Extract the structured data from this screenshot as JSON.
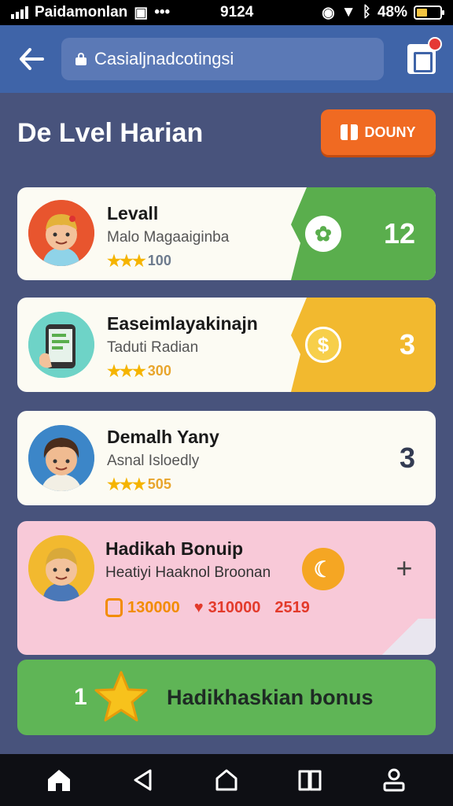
{
  "status_bar": {
    "carrier": "Paidamonlan",
    "time": "9124",
    "battery": "48%",
    "battery_level": 0.48
  },
  "app_bar": {
    "url": "Casialjnadcotingsi"
  },
  "header": {
    "title": "De Lvel Harian",
    "action_label": "DOUNY"
  },
  "cards": [
    {
      "title": "Levall",
      "subtitle": "Malo Magaaiginba",
      "rating": "100",
      "count": "12",
      "tag_color": "#5aae4d"
    },
    {
      "title": "Easeimlayakinajn",
      "subtitle": "Taduti Radian",
      "rating": "300",
      "count": "3",
      "tag_color": "#f2b92f"
    },
    {
      "title": "Demalh Yany",
      "subtitle": "Asnal Isloedly",
      "rating": "505",
      "count": "3"
    }
  ],
  "bonus_card": {
    "title": "Hadikah Bonuip",
    "subtitle": "Heatiyi Haaknol Broonan",
    "coins": "130000",
    "hearts": "310000",
    "extra": "2519"
  },
  "cta": {
    "count": "1",
    "label": "Hadikhaskian bonus"
  },
  "colors": {
    "app_bar": "#3f64a8",
    "background": "#48537c",
    "accent_orange": "#f06a22",
    "green": "#5fb556",
    "yellow": "#f2b92f",
    "pink": "#f8c9d8"
  }
}
